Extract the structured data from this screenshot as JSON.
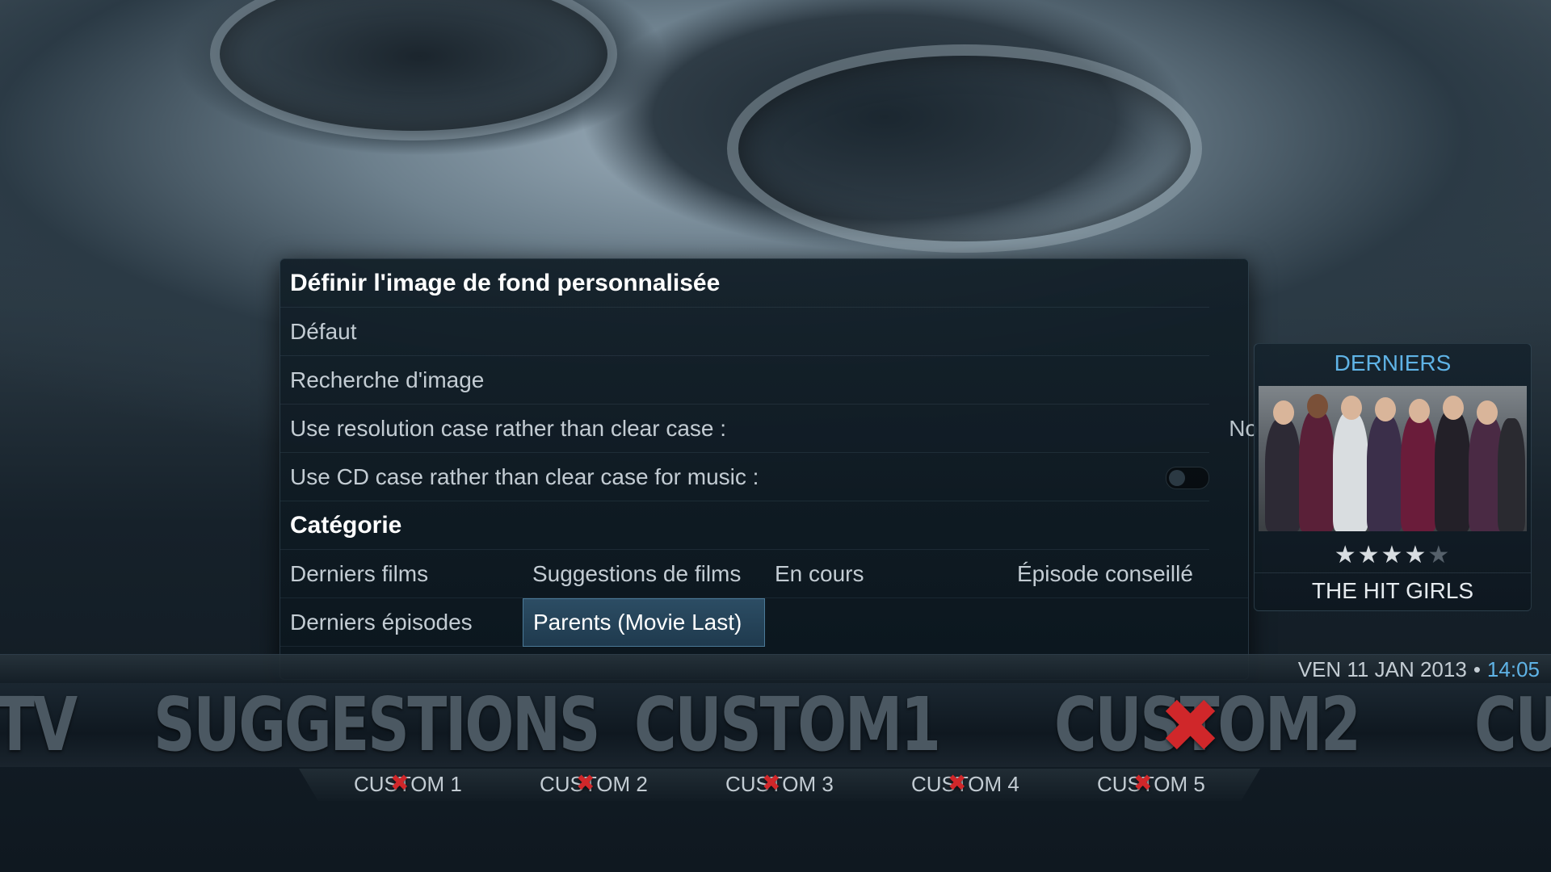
{
  "dialog": {
    "title": "Définir l'image de fond personnalisée",
    "options": [
      {
        "label": "Défaut"
      },
      {
        "label": "Recherche d'image"
      },
      {
        "label": "Use resolution case rather than clear case :",
        "value": "No"
      },
      {
        "label": "Use CD case rather than clear case for music :"
      }
    ],
    "category_header": "Catégorie",
    "categories": [
      "Derniers films",
      "Suggestions de films",
      "En cours",
      "Épisode conseillé",
      "Derniers épisodes",
      "Parents (Movie Last)"
    ],
    "focused_category": "Parents (Movie Last)"
  },
  "widget": {
    "title": "DERNIERS",
    "rating": 4,
    "rating_max": 5,
    "movie_title": "THE HIT GIRLS"
  },
  "status": {
    "date": "VEN 11 JAN 2013",
    "separator": "•",
    "time": "14:05"
  },
  "main_menu": [
    "TV",
    "SUGGESTIONS",
    "CUSTOM1",
    "CUSTOM2",
    "CU"
  ],
  "sub_menu": [
    "CUSTOM 1",
    "CUSTOM 2",
    "CUSTOM 3",
    "CUSTOM 4",
    "CUSTOM 5"
  ],
  "colors": {
    "accent": "#5fb3e6",
    "focus": "#2c4d64",
    "disabled_mark": "#d0272a"
  }
}
